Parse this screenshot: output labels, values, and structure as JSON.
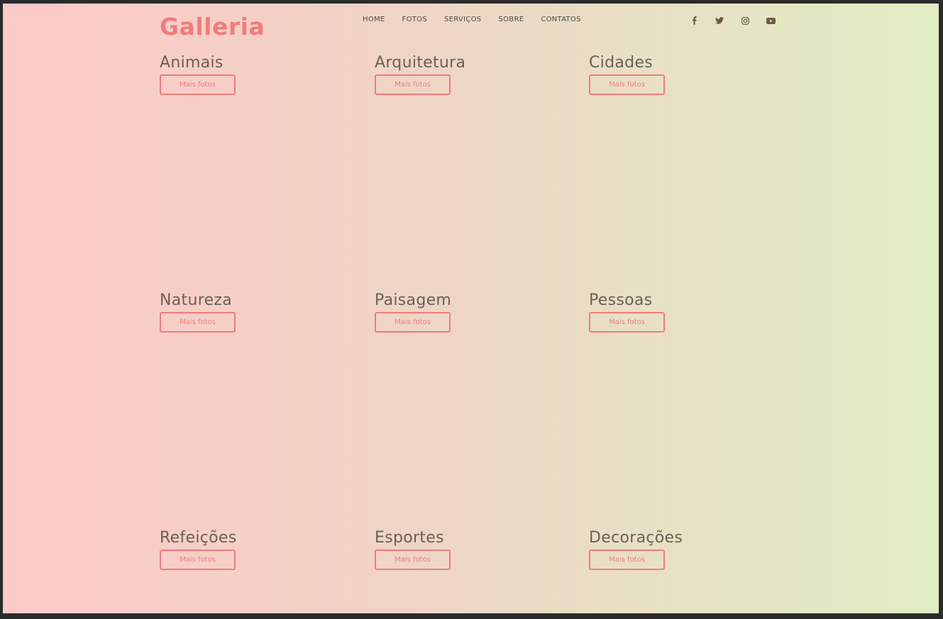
{
  "header": {
    "logo": "Galleria",
    "nav": [
      "HOME",
      "FOTOS",
      "SERVIÇOS",
      "SOBRE",
      "CONTATOS"
    ],
    "social": [
      "facebook-icon",
      "twitter-icon",
      "instagram-icon",
      "youtube-icon"
    ]
  },
  "categories": [
    {
      "title": "Animais",
      "button": "Mais fotos"
    },
    {
      "title": "Arquitetura",
      "button": "Mais fotos"
    },
    {
      "title": "Cidades",
      "button": "Mais fotos"
    },
    {
      "title": "Natureza",
      "button": "Mais fotos"
    },
    {
      "title": "Paisagem",
      "button": "Mais fotos"
    },
    {
      "title": "Pessoas",
      "button": "Mais fotos"
    },
    {
      "title": "Refeições",
      "button": "Mais fotos"
    },
    {
      "title": "Esportes",
      "button": "Mais fotos"
    },
    {
      "title": "Decorações",
      "button": "Mais fotos"
    }
  ],
  "colors": {
    "accent": "#f07c7c",
    "text": "#6a6058",
    "gradient_start": "#fdc9c9",
    "gradient_end": "#e0edc4"
  }
}
